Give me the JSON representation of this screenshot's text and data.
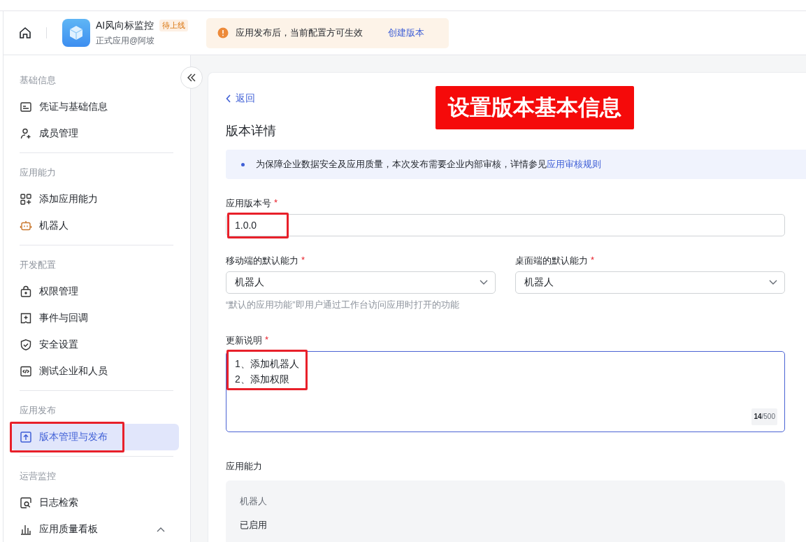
{
  "header": {
    "app_name": "AI风向标监控",
    "badge": "待上线",
    "subtitle": "正式应用@阿坡",
    "notice": {
      "text": "应用发布后，当前配置方可生效",
      "link": "创建版本"
    }
  },
  "sidebar": {
    "sections": [
      {
        "title": "基础信息",
        "items": [
          {
            "label": "凭证与基础信息",
            "selected": false,
            "marked": false
          },
          {
            "label": "成员管理",
            "selected": false,
            "marked": false
          }
        ]
      },
      {
        "title": "应用能力",
        "items": [
          {
            "label": "添加应用能力",
            "selected": false,
            "marked": false
          },
          {
            "label": "机器人",
            "selected": false,
            "marked": false
          }
        ]
      },
      {
        "title": "开发配置",
        "items": [
          {
            "label": "权限管理",
            "selected": false,
            "marked": false
          },
          {
            "label": "事件与回调",
            "selected": false,
            "marked": false
          },
          {
            "label": "安全设置",
            "selected": false,
            "marked": false
          },
          {
            "label": "测试企业和人员",
            "selected": false,
            "marked": false
          }
        ]
      },
      {
        "title": "应用发布",
        "items": [
          {
            "label": "版本管理与发布",
            "selected": true,
            "marked": true
          }
        ]
      },
      {
        "title": "运营监控",
        "items": [
          {
            "label": "日志检索",
            "selected": false,
            "marked": false
          },
          {
            "label": "应用质量看板",
            "selected": false,
            "marked": false,
            "expanded": true
          }
        ]
      }
    ]
  },
  "main": {
    "back": "返回",
    "annotation": "设置版本基本信息",
    "title": "版本详情",
    "info": {
      "text": "为保障企业数据安全及应用质量，本次发布需要企业内部审核，详情参见",
      "link": "应用审核规则"
    },
    "version": {
      "label": "应用版本号",
      "required": "*",
      "value": "1.0.0",
      "marked": true
    },
    "mobile_default": {
      "label": "移动端的默认能力",
      "required": "*",
      "value": "机器人"
    },
    "desktop_default": {
      "label": "桌面端的默认能力",
      "required": "*",
      "value": "机器人"
    },
    "default_hint": "“默认的应用功能”即用户通过工作台访问应用时打开的功能",
    "notes": {
      "label": "更新说明",
      "required": "*",
      "lines": [
        "1、添加机器人",
        "2、添加权限"
      ],
      "count": "14",
      "max": "/500",
      "marked": true
    },
    "capabilities": {
      "label": "应用能力",
      "name": "机器人",
      "status": "已启用"
    }
  }
}
